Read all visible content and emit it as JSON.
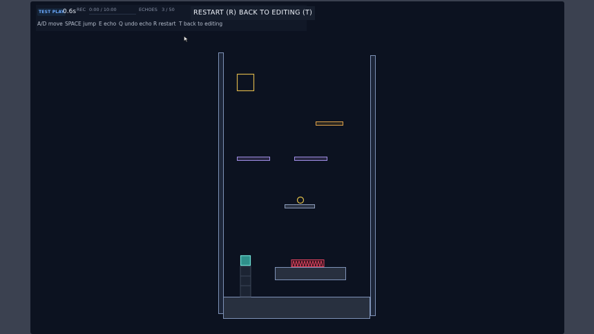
{
  "hud": {
    "mode_badge": "TEST PLAY",
    "timer": "0.6s",
    "rec_label": "REC",
    "rec_time": "0:00 / 10:00",
    "echoes_label": "ECHOES",
    "echoes_count": "3 / 50"
  },
  "buttons": {
    "restart": "RESTART (R)",
    "back_to_editing": "BACK TO EDITING (T)"
  },
  "help": [
    {
      "key": "A/D",
      "action": "move"
    },
    {
      "key": "SPACE",
      "action": "jump"
    },
    {
      "key": "E",
      "action": "echo"
    },
    {
      "key": "Q",
      "action": "undo echo"
    },
    {
      "key": "R",
      "action": "restart"
    },
    {
      "key": "T",
      "action": "back to editing"
    }
  ],
  "colors": {
    "stage_bg": "#0c1220",
    "wall_stroke": "#7f93b8",
    "goal_stroke": "#d8b24a",
    "orange_platform": "#e0a24b",
    "purple_platform": "#a08ee6",
    "player_fill": "#2f8f8a",
    "player_stroke": "#6fe0d6",
    "spike": "#e04460",
    "coin": "#e5c34a"
  }
}
